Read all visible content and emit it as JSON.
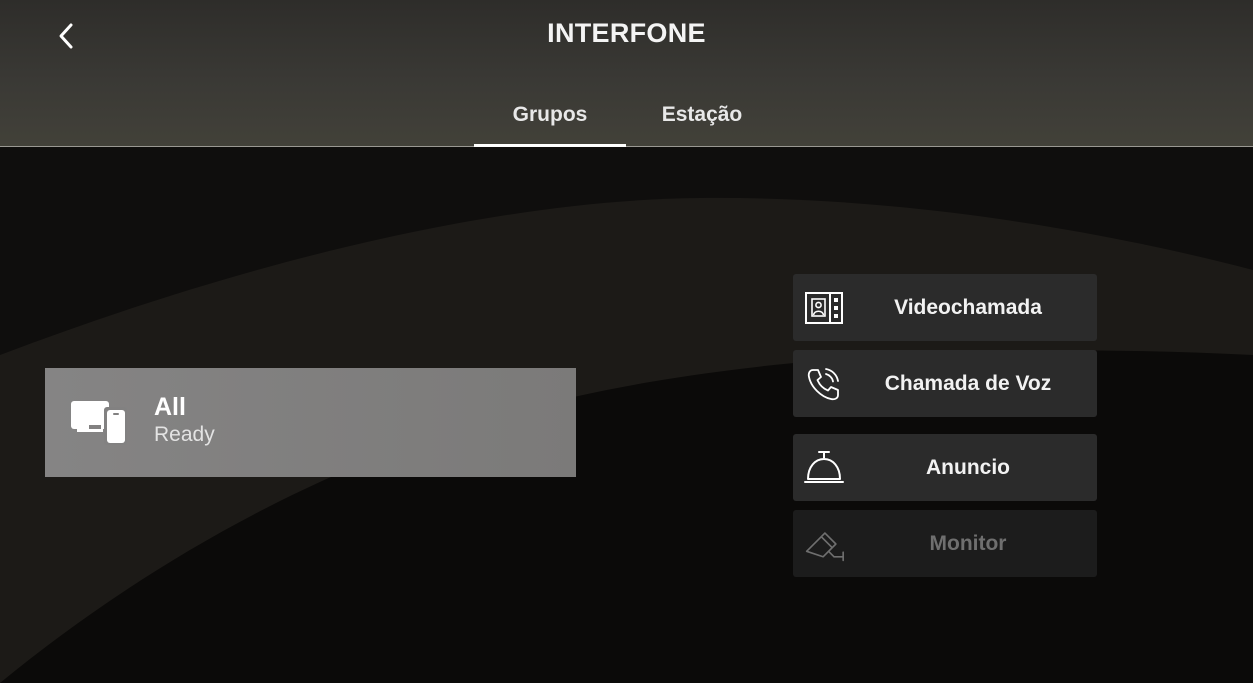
{
  "header": {
    "title": "INTERFONE",
    "back_icon": "chevron-left-icon"
  },
  "tabs": [
    {
      "label": "Grupos",
      "active": true
    },
    {
      "label": "Estação",
      "active": false
    }
  ],
  "group": {
    "name": "All",
    "status": "Ready",
    "icon": "devices-icon"
  },
  "actions": [
    {
      "label": "Videochamada",
      "icon": "video-intercom-icon",
      "enabled": true
    },
    {
      "label": "Chamada de Voz",
      "icon": "phone-call-icon",
      "enabled": true
    },
    {
      "label": "Anuncio",
      "icon": "service-bell-icon",
      "enabled": true
    },
    {
      "label": "Monitor",
      "icon": "camera-icon",
      "enabled": false
    }
  ],
  "colors": {
    "header_bg": "#3a3935",
    "card_bg": "#828181",
    "button_bg": "#2b2b2b",
    "disabled_text": "#6f6f6f",
    "accent": "#ffffff"
  }
}
